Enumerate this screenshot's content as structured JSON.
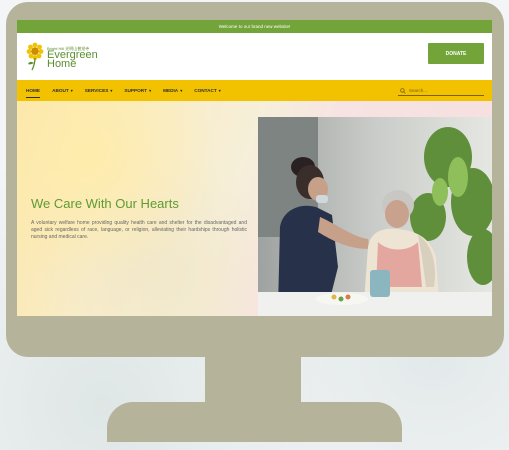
{
  "topbar": {
    "welcome_text": "Welcome to our brand new website!"
  },
  "logo": {
    "small_text": "Bright Hill 光明山普觉寺",
    "name": "Evergreen Home"
  },
  "header": {
    "donate_label": "DONATE"
  },
  "nav": {
    "items": [
      {
        "label": "HOME",
        "dropdown": false
      },
      {
        "label": "ABOUT",
        "dropdown": true
      },
      {
        "label": "SERVICES",
        "dropdown": true
      },
      {
        "label": "SUPPORT",
        "dropdown": true
      },
      {
        "label": "MEDIA",
        "dropdown": true
      },
      {
        "label": "CONTACT",
        "dropdown": true
      }
    ],
    "caret": "▾"
  },
  "search": {
    "placeholder": "Search..."
  },
  "hero": {
    "title": "We Care With Our Hearts",
    "description": "A voluntary welfare home providing quality health care and shelter for the disadvantaged and aged sick regardless of race, language, or religion, alleviating their hardships through holistic nursing and medical care."
  },
  "colors": {
    "brand_green": "#72a43a",
    "nav_yellow": "#f2c200",
    "monitor": "#b6b39b"
  }
}
